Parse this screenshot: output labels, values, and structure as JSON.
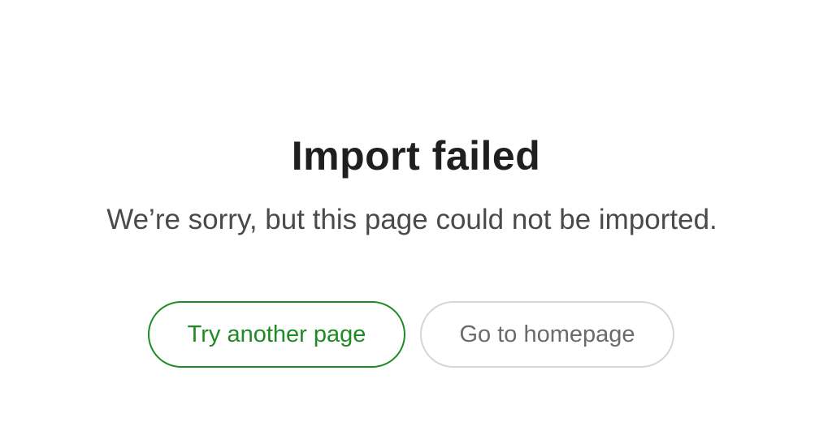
{
  "dialog": {
    "title": "Import failed",
    "message": "We’re sorry, but this page could not be imported.",
    "primary_button_label": "Try another page",
    "secondary_button_label": "Go to homepage"
  },
  "colors": {
    "primary_accent": "#1f8b24",
    "secondary_border": "#d6d6d6",
    "title_text": "#1f1f1f",
    "message_text": "#4a4a4a"
  }
}
